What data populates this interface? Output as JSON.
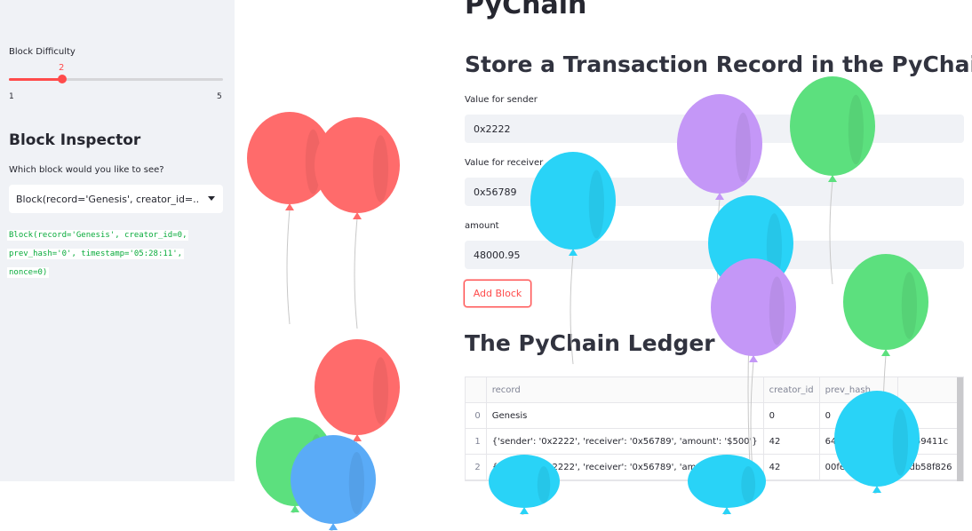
{
  "sidebar": {
    "slider": {
      "label": "Block Difficulty",
      "value": "2",
      "min": "1",
      "max": "5",
      "level": 0.25
    },
    "inspector_title": "Block Inspector",
    "question": "Which block would you like to see?",
    "selected_block": "Block(record='Genesis', creator_id=...",
    "code_lines": [
      "Block(record='Genesis', creator_id=0,",
      "prev_hash='0', timestamp='05:28:11',",
      "nonce=0)"
    ]
  },
  "main": {
    "title": "PyChain",
    "form_heading": "Store a Transaction Record in the PyChain",
    "sender": {
      "label": "Value for sender",
      "value": "0x2222"
    },
    "receiver": {
      "label": "Value for receiver",
      "value": "0x56789"
    },
    "amount": {
      "label": "amount",
      "value": "48000.95"
    },
    "add_button": "Add Block",
    "ledger_heading": "The PyChain Ledger",
    "table": {
      "columns": [
        "",
        "record",
        "creator_id",
        "prev_hash",
        ""
      ],
      "rows": [
        [
          "0",
          "Genesis",
          "0",
          "0",
          ""
        ],
        [
          "1",
          "{'sender': '0x2222', 'receiver': '0x56789', 'amount': '$500'}",
          "42",
          "6486c",
          "0559411c"
        ],
        [
          "2",
          "{'sender': '0x2222', 'receiver': '0x56789', 'amount': '",
          "42",
          "00fe974",
          "6db58f826"
        ]
      ]
    }
  },
  "colors": {
    "accent": "#ff4b4b",
    "sidebar_bg": "#f0f2f6",
    "balloon_red": "#ff6b6b",
    "balloon_green": "#5ce07e",
    "balloon_blue": "#29d3f7",
    "balloon_purple": "#c497f7"
  },
  "balloons": [
    {
      "name": "balloon-red-1",
      "color": "#ff6b6b"
    },
    {
      "name": "balloon-red-2",
      "color": "#ff6b6b"
    },
    {
      "name": "balloon-red-3",
      "color": "#ff6b6b"
    },
    {
      "name": "balloon-green-1",
      "color": "#5ce07e"
    },
    {
      "name": "balloon-blue-1",
      "color": "#5aabf7"
    },
    {
      "name": "balloon-purple-1",
      "color": "#c497f7"
    },
    {
      "name": "balloon-green-2",
      "color": "#5ce07e"
    },
    {
      "name": "balloon-cyan-1",
      "color": "#29d3f7"
    },
    {
      "name": "balloon-cyan-2",
      "color": "#29d3f7"
    },
    {
      "name": "balloon-purple-2",
      "color": "#c497f7"
    },
    {
      "name": "balloon-green-3",
      "color": "#5ce07e"
    },
    {
      "name": "balloon-cyan-3",
      "color": "#29d3f7"
    },
    {
      "name": "balloon-cyan-4",
      "color": "#29d3f7"
    },
    {
      "name": "balloon-cyan-5",
      "color": "#29d3f7"
    }
  ]
}
